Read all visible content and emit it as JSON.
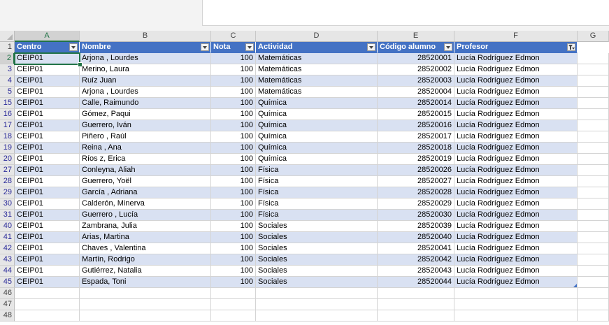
{
  "columns": [
    "A",
    "B",
    "C",
    "D",
    "E",
    "F",
    "G"
  ],
  "active_cell": {
    "column": "A",
    "row": "2"
  },
  "table": {
    "header_row_number": "1",
    "headers": [
      "Centro",
      "Nombre",
      "Nota",
      "Actividad",
      "Código alumno",
      "Profesor"
    ],
    "filtered_column": "Profesor",
    "rows": [
      {
        "rn": "2",
        "centro": "CEIP01",
        "nombre": "Arjona , Lourdes",
        "nota": "100",
        "actividad": "Matemáticas",
        "codigo": "28520001",
        "profesor": "Lucía Rodríguez Edmon"
      },
      {
        "rn": "3",
        "centro": "CEIP01",
        "nombre": "Merino, Laura",
        "nota": "100",
        "actividad": "Matemáticas",
        "codigo": "28520002",
        "profesor": "Lucía Rodríguez Edmon"
      },
      {
        "rn": "4",
        "centro": "CEIP01",
        "nombre": "Ruíz Juan",
        "nota": "100",
        "actividad": "Matemáticas",
        "codigo": "28520003",
        "profesor": "Lucía Rodríguez Edmon"
      },
      {
        "rn": "5",
        "centro": "CEIP01",
        "nombre": "Arjona , Lourdes",
        "nota": "100",
        "actividad": "Matemáticas",
        "codigo": "28520004",
        "profesor": "Lucía Rodríguez Edmon"
      },
      {
        "rn": "15",
        "centro": "CEIP01",
        "nombre": "Calle, Raimundo",
        "nota": "100",
        "actividad": "Química",
        "codigo": "28520014",
        "profesor": "Lucía Rodríguez Edmon"
      },
      {
        "rn": "16",
        "centro": "CEIP01",
        "nombre": "Gómez, Paqui",
        "nota": "100",
        "actividad": "Química",
        "codigo": "28520015",
        "profesor": "Lucía Rodríguez Edmon"
      },
      {
        "rn": "17",
        "centro": "CEIP01",
        "nombre": "Guerrero, Iván",
        "nota": "100",
        "actividad": "Química",
        "codigo": "28520016",
        "profesor": "Lucía Rodríguez Edmon"
      },
      {
        "rn": "18",
        "centro": "CEIP01",
        "nombre": "Piñero , Raúl",
        "nota": "100",
        "actividad": "Química",
        "codigo": "28520017",
        "profesor": "Lucía Rodríguez Edmon"
      },
      {
        "rn": "19",
        "centro": "CEIP01",
        "nombre": "Reina , Ana",
        "nota": "100",
        "actividad": "Química",
        "codigo": "28520018",
        "profesor": "Lucía Rodríguez Edmon"
      },
      {
        "rn": "20",
        "centro": "CEIP01",
        "nombre": "Ríos z, Erica",
        "nota": "100",
        "actividad": "Química",
        "codigo": "28520019",
        "profesor": "Lucía Rodríguez Edmon"
      },
      {
        "rn": "27",
        "centro": "CEIP01",
        "nombre": "Conleyna, Aliah",
        "nota": "100",
        "actividad": "Física",
        "codigo": "28520026",
        "profesor": "Lucía Rodríguez Edmon"
      },
      {
        "rn": "28",
        "centro": "CEIP01",
        "nombre": "Guerrero, Yoël",
        "nota": "100",
        "actividad": "Física",
        "codigo": "28520027",
        "profesor": "Lucía Rodríguez Edmon"
      },
      {
        "rn": "29",
        "centro": "CEIP01",
        "nombre": "García , Adriana",
        "nota": "100",
        "actividad": "Física",
        "codigo": "28520028",
        "profesor": "Lucía Rodríguez Edmon"
      },
      {
        "rn": "30",
        "centro": "CEIP01",
        "nombre": "Calderón, Minerva",
        "nota": "100",
        "actividad": "Física",
        "codigo": "28520029",
        "profesor": "Lucía Rodríguez Edmon"
      },
      {
        "rn": "31",
        "centro": "CEIP01",
        "nombre": "Guerrero , Lucía",
        "nota": "100",
        "actividad": "Física",
        "codigo": "28520030",
        "profesor": "Lucía Rodríguez Edmon"
      },
      {
        "rn": "40",
        "centro": "CEIP01",
        "nombre": "Zambrana, Julia",
        "nota": "100",
        "actividad": "Sociales",
        "codigo": "28520039",
        "profesor": "Lucía Rodríguez Edmon"
      },
      {
        "rn": "41",
        "centro": "CEIP01",
        "nombre": "Arias, Martina",
        "nota": "100",
        "actividad": "Sociales",
        "codigo": "28520040",
        "profesor": "Lucía Rodríguez Edmon"
      },
      {
        "rn": "42",
        "centro": "CEIP01",
        "nombre": "Chaves , Valentina",
        "nota": "100",
        "actividad": "Sociales",
        "codigo": "28520041",
        "profesor": "Lucía Rodríguez Edmon"
      },
      {
        "rn": "43",
        "centro": "CEIP01",
        "nombre": "Martín, Rodrigo",
        "nota": "100",
        "actividad": "Sociales",
        "codigo": "28520042",
        "profesor": "Lucía Rodríguez Edmon"
      },
      {
        "rn": "44",
        "centro": "CEIP01",
        "nombre": "Gutiérrez, Natalia",
        "nota": "100",
        "actividad": "Sociales",
        "codigo": "28520043",
        "profesor": "Lucía Rodríguez Edmon"
      },
      {
        "rn": "45",
        "centro": "CEIP01",
        "nombre": "Espada, Toni",
        "nota": "100",
        "actividad": "Sociales",
        "codigo": "28520044",
        "profesor": "Lucía Rodríguez Edmon"
      }
    ]
  },
  "empty_rows": [
    "46",
    "47",
    "48"
  ],
  "colors": {
    "header_fill": "#4472c4",
    "band_fill": "#d9e1f2",
    "select": "#217346",
    "filtered_row_number": "#2a2a9a"
  }
}
